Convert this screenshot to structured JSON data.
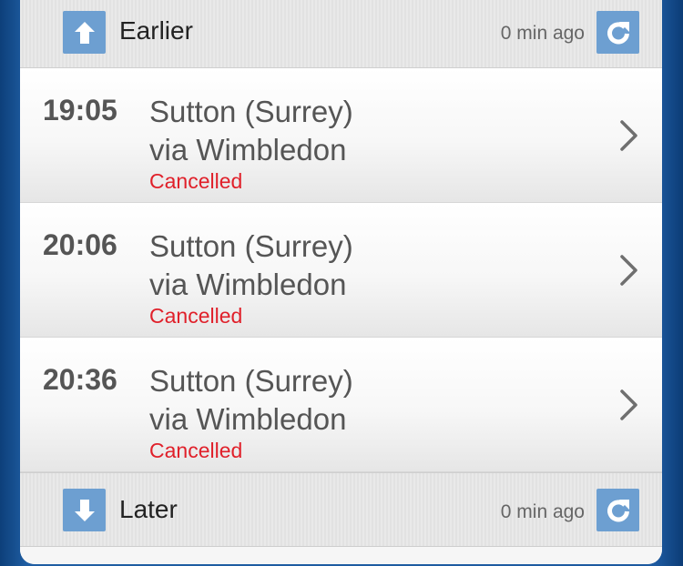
{
  "earlier": {
    "label": "Earlier",
    "updated": "0 min ago",
    "arrow_icon": "arrow-up-icon",
    "refresh_icon": "refresh-icon"
  },
  "services": [
    {
      "time": "19:05",
      "destination": "Sutton (Surrey)",
      "via": "via Wimbledon",
      "status": "Cancelled"
    },
    {
      "time": "20:06",
      "destination": "Sutton (Surrey)",
      "via": "via Wimbledon",
      "status": "Cancelled"
    },
    {
      "time": "20:36",
      "destination": "Sutton (Surrey)",
      "via": "via Wimbledon",
      "status": "Cancelled"
    }
  ],
  "later": {
    "label": "Later",
    "updated": "0 min ago",
    "arrow_icon": "arrow-down-icon",
    "refresh_icon": "refresh-icon"
  },
  "colors": {
    "accent": "#6d9fd1",
    "cancelled": "#e0202a",
    "background": "#1d5aa0"
  }
}
